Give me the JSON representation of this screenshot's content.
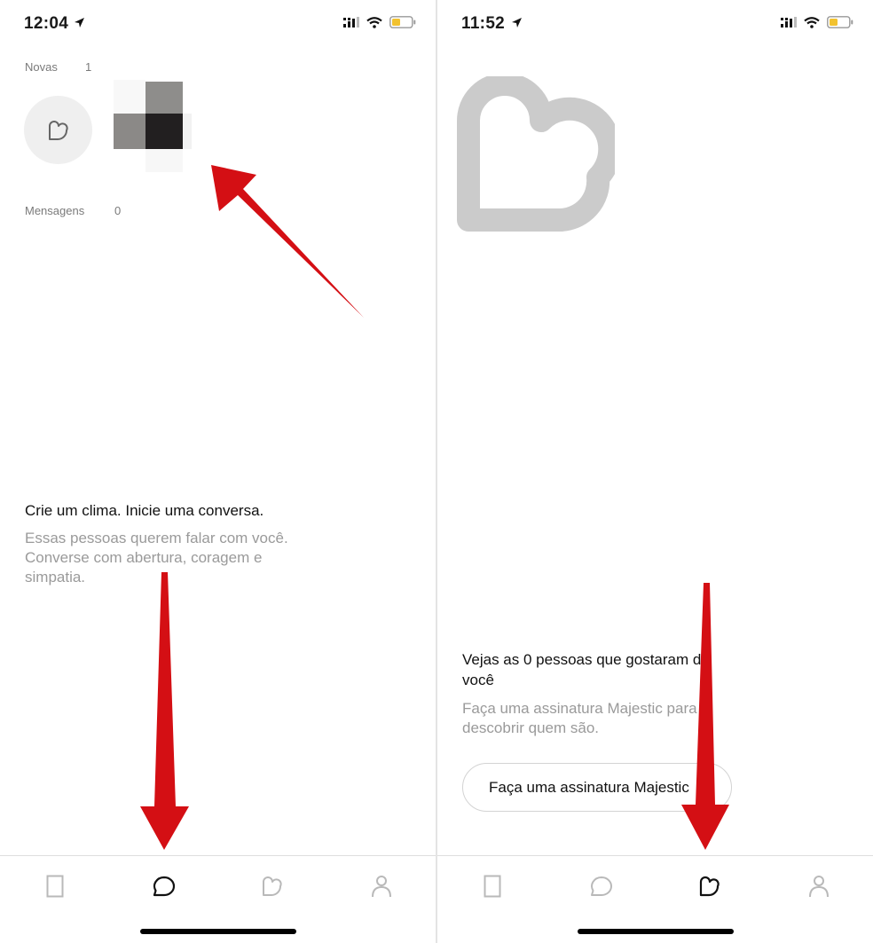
{
  "left": {
    "status": {
      "time": "12:04"
    },
    "new_section": {
      "label": "Novas",
      "count": "1"
    },
    "messages_section": {
      "label": "Mensagens",
      "count": "0"
    },
    "empty_state": {
      "title": "Crie um clima. Inicie uma conversa.",
      "body_line1": "Essas pessoas querem falar com você.",
      "body_line2": "Converse com abertura, coragem e",
      "body_line3": "simpatia."
    },
    "tabs": [
      {
        "icon": "discover-card-icon",
        "active": false
      },
      {
        "icon": "chat-bubble-icon",
        "active": true
      },
      {
        "icon": "likes-heart-icon",
        "active": false
      },
      {
        "icon": "profile-person-icon",
        "active": false
      }
    ]
  },
  "right": {
    "status": {
      "time": "11:52"
    },
    "likes": {
      "title_line1": "Vejas as 0 pessoas que gostaram de",
      "title_line2": "você",
      "body_line1": "Faça uma assinatura Majestic para",
      "body_line2": "descobrir quem são.",
      "button_label": "Faça uma assinatura Majestic"
    },
    "tabs": [
      {
        "icon": "discover-card-icon",
        "active": false
      },
      {
        "icon": "chat-bubble-icon",
        "active": false
      },
      {
        "icon": "likes-heart-icon",
        "active": true
      },
      {
        "icon": "profile-person-icon",
        "active": false
      }
    ]
  },
  "colors": {
    "annotation_arrow": "#d40f14",
    "inactive_icon": "#b9b9b9",
    "active_icon": "#111111",
    "heart_gray": "#cbcbcb"
  }
}
